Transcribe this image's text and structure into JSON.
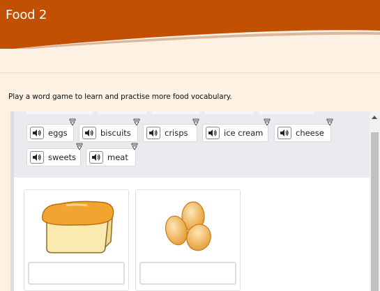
{
  "header": {
    "title": "Food 2",
    "brand_color": "#c15003"
  },
  "intro": {
    "text": "Play a word game to learn and practise more food vocabulary."
  },
  "word_bank": {
    "words": [
      "eggs",
      "biscuits",
      "crisps",
      "ice cream",
      "cheese",
      "sweets",
      "meat"
    ]
  },
  "cards": [
    {
      "image": "bread-loaf",
      "answer": ""
    },
    {
      "image": "eggs",
      "answer": ""
    }
  ]
}
